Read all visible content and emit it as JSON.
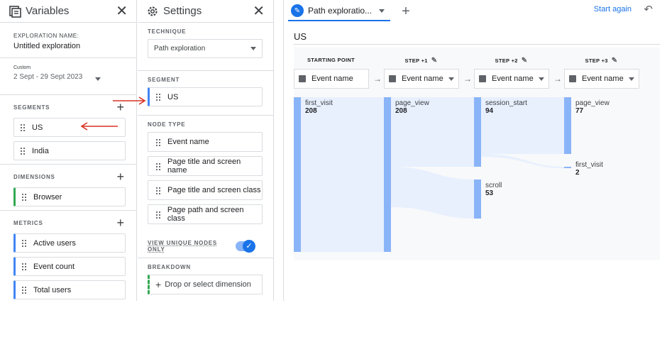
{
  "variables": {
    "title": "Variables",
    "exploration_name_label": "EXPLORATION NAME:",
    "exploration_name": "Untitled exploration",
    "date_tag": "Custom",
    "date_range": "2 Sept - 29 Sept 2023",
    "segments_label": "SEGMENTS",
    "segments": [
      "US",
      "India"
    ],
    "dimensions_label": "DIMENSIONS",
    "dimensions": [
      "Browser"
    ],
    "metrics_label": "METRICS",
    "metrics": [
      "Active users",
      "Event count",
      "Total users"
    ]
  },
  "settings": {
    "title": "Settings",
    "technique_label": "TECHNIQUE",
    "technique": "Path exploration",
    "segment_label": "SEGMENT",
    "segment": "US",
    "node_type_label": "NODE TYPE",
    "node_types": [
      "Event name",
      "Page title and screen name",
      "Page title and screen class",
      "Page path and screen class"
    ],
    "unique_nodes_label": "VIEW UNIQUE NODES ONLY",
    "breakdown_label": "BREAKDOWN",
    "breakdown_placeholder": "Drop or select dimension"
  },
  "main": {
    "tab_label": "Path exploratio...",
    "start_again": "Start again",
    "title": "US",
    "steps": [
      {
        "label": "STARTING POINT",
        "node": "Event name"
      },
      {
        "label": "STEP +1",
        "node": "Event name"
      },
      {
        "label": "STEP +2",
        "node": "Event name"
      },
      {
        "label": "STEP +3",
        "node": "Event name"
      }
    ],
    "nodes": [
      {
        "name": "first_visit",
        "value": "208"
      },
      {
        "name": "page_view",
        "value": "208"
      },
      {
        "name": "session_start",
        "value": "94"
      },
      {
        "name": "scroll",
        "value": "53"
      },
      {
        "name": "page_view",
        "value": "77"
      },
      {
        "name": "first_visit",
        "value": "2"
      }
    ]
  },
  "colors": {
    "accent": "#1a73e8",
    "node": "#8ab4f8",
    "flow": "#e8f0fe",
    "annotation": "#d93025"
  }
}
